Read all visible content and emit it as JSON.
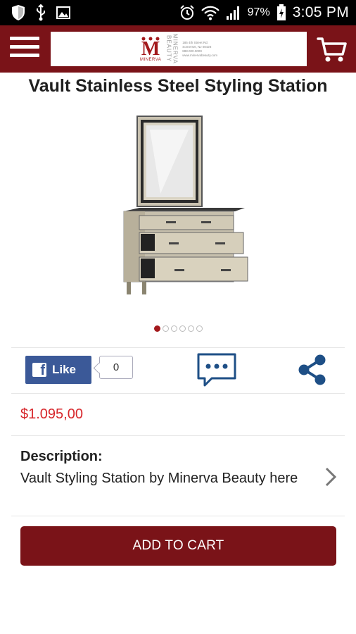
{
  "status_bar": {
    "battery_percent": "97%",
    "time": "3:05 PM",
    "left_icons": [
      "shield-icon",
      "usb-icon",
      "image-icon"
    ],
    "right_icons": [
      "alarm-icon",
      "wifi-icon",
      "signal-icon",
      "battery-charging-icon"
    ]
  },
  "app_bar": {
    "menu_icon": "hamburger-menu-icon",
    "cart_icon": "shopping-cart-icon",
    "logo": {
      "letter": "M",
      "subtext": "MINERVA",
      "vertical_text": "MINERVA BEAUTY",
      "address_lines": [
        "185 4th Street Rd.",
        "Somerset, NJ 08428",
        "888.000.0000",
        "www.minervabeauty.com"
      ]
    },
    "brand_color": "#7a1318"
  },
  "product": {
    "title": "Vault Stainless Steel Styling Station",
    "image_alt": "styling-station-image",
    "carousel": {
      "total": 6,
      "active_index": 0
    },
    "price": "$1.095,00",
    "price_color": "#d7262b"
  },
  "social": {
    "like_label": "Like",
    "like_count": "0",
    "comment_icon": "chat-bubble-icon",
    "share_icon": "share-icon"
  },
  "description": {
    "label": "Description:",
    "text": "Vault Styling Station by Minerva Beauty here"
  },
  "actions": {
    "add_to_cart": "ADD TO CART"
  }
}
